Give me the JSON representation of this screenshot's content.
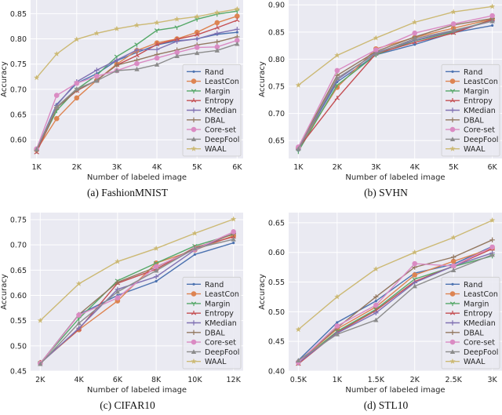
{
  "chart_data": [
    {
      "type": "line",
      "caption": "(a) FashionMNIST",
      "xlabel": "Number of labeled image",
      "ylabel": "Accuracy",
      "x": [
        1000,
        1500,
        2000,
        2500,
        3000,
        3500,
        4000,
        4500,
        5000,
        5500,
        6000
      ],
      "xticks": [
        1000,
        2000,
        3000,
        4000,
        5000,
        6000
      ],
      "xtick_labels": [
        "1K",
        "2K",
        "3K",
        "4K",
        "5K",
        "6K"
      ],
      "xlim": [
        850,
        6150
      ],
      "yticks": [
        0.6,
        0.65,
        0.7,
        0.75,
        0.8,
        0.85
      ],
      "ytick_labels": [
        "0.60",
        "0.65",
        "0.70",
        "0.75",
        "0.80",
        "0.85"
      ],
      "ylim": [
        0.563,
        0.877
      ],
      "grid": true,
      "legend_position": "lower-right",
      "series": [
        {
          "name": "Rand",
          "values": [
            0.58,
            0.67,
            0.712,
            0.731,
            0.757,
            0.773,
            0.788,
            0.796,
            0.8,
            0.809,
            0.813
          ]
        },
        {
          "name": "LeastCon",
          "values": [
            0.58,
            0.642,
            0.683,
            0.718,
            0.75,
            0.777,
            0.792,
            0.8,
            0.813,
            0.832,
            0.845
          ]
        },
        {
          "name": "Margin",
          "values": [
            0.578,
            0.658,
            0.7,
            0.728,
            0.765,
            0.789,
            0.817,
            0.823,
            0.839,
            0.849,
            0.855
          ]
        },
        {
          "name": "Entropy",
          "values": [
            0.575,
            0.664,
            0.697,
            0.718,
            0.748,
            0.767,
            0.789,
            0.799,
            0.808,
            0.822,
            0.837
          ]
        },
        {
          "name": "KMedian",
          "values": [
            0.58,
            0.668,
            0.715,
            0.738,
            0.758,
            0.778,
            0.779,
            0.795,
            0.8,
            0.811,
            0.819
          ]
        },
        {
          "name": "DBAL",
          "values": [
            0.58,
            0.664,
            0.698,
            0.718,
            0.748,
            0.758,
            0.769,
            0.778,
            0.788,
            0.794,
            0.804
          ]
        },
        {
          "name": "Core-set",
          "values": [
            0.582,
            0.688,
            0.712,
            0.726,
            0.737,
            0.751,
            0.762,
            0.773,
            0.783,
            0.784,
            0.797
          ]
        },
        {
          "name": "DeepFool",
          "values": [
            0.581,
            0.665,
            0.701,
            0.717,
            0.737,
            0.74,
            0.749,
            0.766,
            0.772,
            0.777,
            0.79
          ]
        },
        {
          "name": "WAAL",
          "values": [
            0.723,
            0.77,
            0.799,
            0.811,
            0.82,
            0.827,
            0.832,
            0.839,
            0.844,
            0.852,
            0.859
          ]
        }
      ]
    },
    {
      "type": "line",
      "caption": "(b) SVHN",
      "xlabel": "Number of labeled image",
      "ylabel": "Accuracy",
      "x": [
        1000,
        2000,
        3000,
        4000,
        5000,
        6000
      ],
      "xticks": [
        1000,
        2000,
        3000,
        4000,
        5000,
        6000
      ],
      "xtick_labels": [
        "1K",
        "2K",
        "3K",
        "4K",
        "5K",
        "6K"
      ],
      "xlim": [
        750,
        6250
      ],
      "yticks": [
        0.65,
        0.7,
        0.75,
        0.8,
        0.85,
        0.9
      ],
      "ytick_labels": [
        "0.65",
        "0.70",
        "0.75",
        "0.80",
        "0.85",
        "0.90"
      ],
      "ylim": [
        0.617,
        0.909
      ],
      "grid": true,
      "legend_position": "lower-right",
      "series": [
        {
          "name": "Rand",
          "values": [
            0.634,
            0.758,
            0.808,
            0.827,
            0.849,
            0.862
          ]
        },
        {
          "name": "LeastCon",
          "values": [
            0.636,
            0.748,
            0.819,
            0.84,
            0.857,
            0.874
          ]
        },
        {
          "name": "Margin",
          "values": [
            0.63,
            0.752,
            0.808,
            0.834,
            0.85,
            0.873
          ]
        },
        {
          "name": "Entropy",
          "values": [
            0.636,
            0.728,
            0.81,
            0.831,
            0.848,
            0.873
          ]
        },
        {
          "name": "KMedian",
          "values": [
            0.634,
            0.762,
            0.812,
            0.835,
            0.852,
            0.87
          ]
        },
        {
          "name": "DBAL",
          "values": [
            0.637,
            0.77,
            0.814,
            0.841,
            0.863,
            0.875
          ]
        },
        {
          "name": "Core-set",
          "values": [
            0.638,
            0.779,
            0.817,
            0.848,
            0.865,
            0.88
          ]
        },
        {
          "name": "DeepFool",
          "values": [
            0.635,
            0.765,
            0.81,
            0.838,
            0.853,
            0.87
          ]
        },
        {
          "name": "WAAL",
          "values": [
            0.752,
            0.807,
            0.839,
            0.868,
            0.887,
            0.897
          ]
        }
      ]
    },
    {
      "type": "line",
      "caption": "(c) CIFAR10",
      "xlabel": "Number of labeled image",
      "ylabel": "Accuracy",
      "x": [
        2000,
        4000,
        6000,
        8000,
        10000,
        12000
      ],
      "xticks": [
        2000,
        4000,
        6000,
        8000,
        10000,
        12000
      ],
      "xtick_labels": [
        "2K",
        "4K",
        "6K",
        "8K",
        "10K",
        "12K"
      ],
      "xlim": [
        1500,
        12500
      ],
      "yticks": [
        0.45,
        0.5,
        0.55,
        0.6,
        0.65,
        0.7,
        0.75
      ],
      "ytick_labels": [
        "0.45",
        "0.50",
        "0.55",
        "0.60",
        "0.65",
        "0.70",
        "0.75"
      ],
      "ylim": [
        0.45,
        0.764
      ],
      "grid": true,
      "legend_position": "lower-right",
      "series": [
        {
          "name": "Rand",
          "values": [
            0.465,
            0.562,
            0.6,
            0.628,
            0.681,
            0.704
          ]
        },
        {
          "name": "LeastCon",
          "values": [
            0.466,
            0.532,
            0.589,
            0.664,
            0.69,
            0.718
          ]
        },
        {
          "name": "Margin",
          "values": [
            0.466,
            0.554,
            0.629,
            0.664,
            0.698,
            0.721
          ]
        },
        {
          "name": "Entropy",
          "values": [
            0.467,
            0.533,
            0.624,
            0.652,
            0.695,
            0.716
          ]
        },
        {
          "name": "KMedian",
          "values": [
            0.465,
            0.535,
            0.612,
            0.637,
            0.69,
            0.723
          ]
        },
        {
          "name": "DBAL",
          "values": [
            0.465,
            0.562,
            0.626,
            0.656,
            0.693,
            0.722
          ]
        },
        {
          "name": "Core-set",
          "values": [
            0.465,
            0.561,
            0.595,
            0.657,
            0.691,
            0.726
          ]
        },
        {
          "name": "DeepFool",
          "values": [
            0.464,
            0.545,
            0.607,
            0.649,
            0.693,
            0.711
          ]
        },
        {
          "name": "WAAL",
          "values": [
            0.55,
            0.623,
            0.667,
            0.693,
            0.723,
            0.751
          ]
        }
      ]
    },
    {
      "type": "line",
      "caption": "(d) STL10",
      "xlabel": "Number of labeled image",
      "ylabel": "Accuracy",
      "x": [
        500,
        1000,
        1500,
        2000,
        2500,
        3000
      ],
      "xticks": [
        500,
        1000,
        1500,
        2000,
        2500,
        3000
      ],
      "xtick_labels": [
        "0.5K",
        "1K",
        "1.5K",
        "2K",
        "2.5K",
        "3K"
      ],
      "xlim": [
        375,
        3125
      ],
      "yticks": [
        0.4,
        0.45,
        0.5,
        0.55,
        0.6,
        0.65
      ],
      "ytick_labels": [
        "0.40",
        "0.45",
        "0.50",
        "0.55",
        "0.60",
        "0.65"
      ],
      "ylim": [
        0.4,
        0.667
      ],
      "grid": true,
      "legend_position": "lower-right",
      "series": [
        {
          "name": "Rand",
          "values": [
            0.418,
            0.482,
            0.518,
            0.565,
            0.58,
            0.61
          ]
        },
        {
          "name": "LeastCon",
          "values": [
            0.415,
            0.471,
            0.508,
            0.562,
            0.585,
            0.607
          ]
        },
        {
          "name": "Margin",
          "values": [
            0.414,
            0.467,
            0.504,
            0.555,
            0.576,
            0.594
          ]
        },
        {
          "name": "Entropy",
          "values": [
            0.412,
            0.465,
            0.502,
            0.551,
            0.577,
            0.606
          ]
        },
        {
          "name": "KMedian",
          "values": [
            0.414,
            0.464,
            0.498,
            0.549,
            0.577,
            0.599
          ]
        },
        {
          "name": "DBAL",
          "values": [
            0.416,
            0.473,
            0.525,
            0.575,
            0.592,
            0.621
          ]
        },
        {
          "name": "Core-set",
          "values": [
            0.415,
            0.476,
            0.511,
            0.581,
            0.577,
            0.609
          ]
        },
        {
          "name": "DeepFool",
          "values": [
            0.418,
            0.462,
            0.486,
            0.543,
            0.57,
            0.596
          ]
        },
        {
          "name": "WAAL",
          "values": [
            0.47,
            0.525,
            0.572,
            0.6,
            0.625,
            0.654
          ]
        }
      ]
    }
  ],
  "styles": {
    "Rand": {
      "color": "#4c72b0",
      "marker": "point"
    },
    "LeastCon": {
      "color": "#dd8452",
      "marker": "circle"
    },
    "Margin": {
      "color": "#55a868",
      "marker": "tri-down"
    },
    "Entropy": {
      "color": "#c44e52",
      "marker": "tri-up"
    },
    "KMedian": {
      "color": "#8172b3",
      "marker": "plus"
    },
    "DBAL": {
      "color": "#937860",
      "marker": "plus"
    },
    "Core-set": {
      "color": "#da8bc3",
      "marker": "circle"
    },
    "DeepFool": {
      "color": "#8c8c8c",
      "marker": "triangle"
    },
    "WAAL": {
      "color": "#ccb974",
      "marker": "star"
    }
  },
  "plot_background": "#eaeaf2",
  "grid_color": "#ffffff"
}
